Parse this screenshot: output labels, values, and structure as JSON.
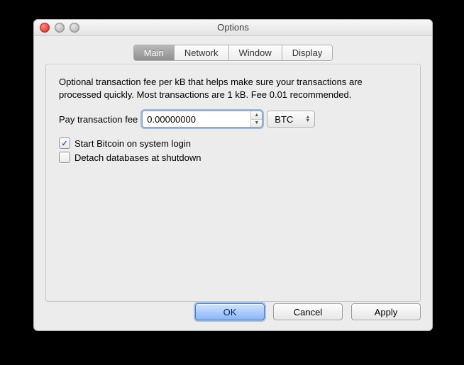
{
  "window": {
    "title": "Options"
  },
  "tabs": {
    "main": "Main",
    "network": "Network",
    "window": "Window",
    "display": "Display"
  },
  "main": {
    "description": "Optional transaction fee per kB that helps make sure your transactions are processed quickly. Most transactions are 1 kB. Fee 0.01 recommended.",
    "fee_label": "Pay transaction fee",
    "fee_value": "0.00000000",
    "unit_selected": "BTC",
    "check_start_label": "Start Bitcoin on system login",
    "check_start_checked": true,
    "check_detach_label": "Detach databases at shutdown",
    "check_detach_checked": false
  },
  "buttons": {
    "ok": "OK",
    "cancel": "Cancel",
    "apply": "Apply"
  }
}
